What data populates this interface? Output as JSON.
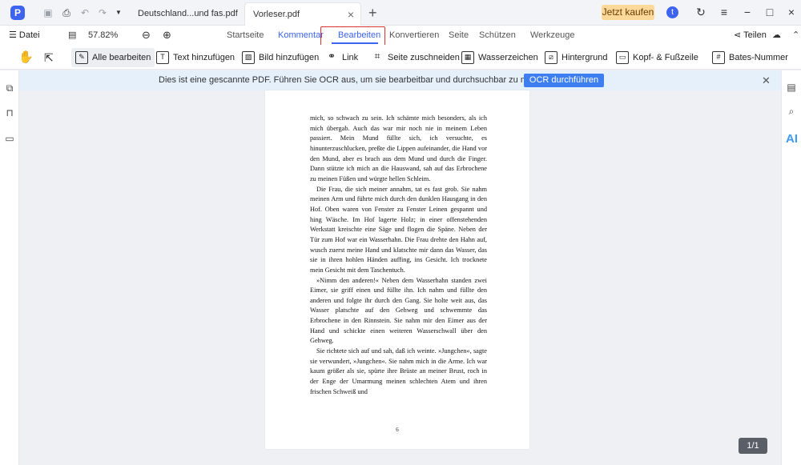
{
  "titlebar": {
    "tabs": [
      {
        "label": "Deutschland...und fas.pdf",
        "active": false
      },
      {
        "label": "Vorleser.pdf",
        "active": true
      }
    ],
    "buy_label": "Jetzt kaufen",
    "avatar_letter": "t",
    "icons": [
      "app-logo",
      "save-icon",
      "print-icon",
      "undo-icon",
      "redo-icon",
      "dropdown-icon",
      "plus-icon",
      "refresh-icon",
      "menu-icon",
      "minimize-icon",
      "maximize-icon",
      "close-icon"
    ]
  },
  "menubar": {
    "file_label": "Datei",
    "zoom": "57.82%",
    "items": [
      "Startseite",
      "Kommentar",
      "Bearbeiten",
      "Konvertieren",
      "Seite",
      "Schützen",
      "Werkzeuge"
    ],
    "active_item": "Bearbeiten",
    "share_label": "Teilen"
  },
  "toolbar": {
    "tools": [
      "Alle bearbeiten",
      "Text hinzufügen",
      "Bild hinzufügen",
      "Link",
      "Seite zuschneiden",
      "Wasserzeichen",
      "Hintergrund",
      "Kopf- & Fußzeile",
      "Bates-Nummer"
    ]
  },
  "ocr_banner": {
    "message": "Dies ist eine gescannte PDF. Führen Sie OCR aus, um sie bearbeitbar und durchsuchbar zu machen.",
    "button_label": "OCR durchführen"
  },
  "document": {
    "paragraphs": [
      "mich, so schwach zu sein. Ich schämte mich besonders, als ich mich übergab. Auch das war mir noch nie in meinem Leben passiert. Mein Mund füllte sich, ich versuchte, es hinunterzuschlucken, preßte die Lippen aufeinander, die Hand vor den Mund, aber es brach aus dem Mund und durch die Finger. Dann stützte ich mich an die Hauswand, sah auf das Erbrochene zu meinen Füßen und würgte hellen Schleim.",
      "Die Frau, die sich meiner annahm, tat es fast grob. Sie nahm meinen Arm und führte mich durch den dunklen Hausgang in den Hof. Oben waren von Fenster zu Fenster Leinen gespannt und hing Wäsche. Im Hof lagerte Holz; in einer offenstehenden Werkstatt kreischte eine Säge und flogen die Späne. Neben der Tür zum Hof war ein Wasserhahn. Die Frau drehte den Hahn auf, wusch zuerst meine Hand und klatschte mir dann das Wasser, das sie in ihren hohlen Händen auffing, ins Gesicht. Ich trocknete mein Gesicht mit dem Taschentuch.",
      "»Nimm den anderen!« Neben dem Wasserhahn standen zwei Eimer, sie griff einen und füllte ihn. Ich nahm und füllte den anderen und folgte ihr durch den Gang. Sie holte weit aus, das Wasser platschte auf den Gehweg und schwemmte das Erbrochene in den Rinnstein. Sie nahm mir den Eimer aus der Hand und schickte einen weiteren Wasserschwall über den Gehweg.",
      "Sie richtete sich auf und sah, daß ich weinte. »Jungchen«, sagte sie verwundert, »Jungchen«. Sie nahm mich in die Arme. Ich war kaum größer als sie, spürte ihre Brüste an meiner Brust, roch in der Enge der Umarmung meinen schlechten Atem und ihren frischen Schweiß und"
    ],
    "page_number": "6"
  },
  "page_indicator": "1/1",
  "colors": {
    "accent": "#3d63f0",
    "buy": "#fcd999",
    "highlight_box": "#e03030",
    "banner": "#e6f0fb"
  }
}
